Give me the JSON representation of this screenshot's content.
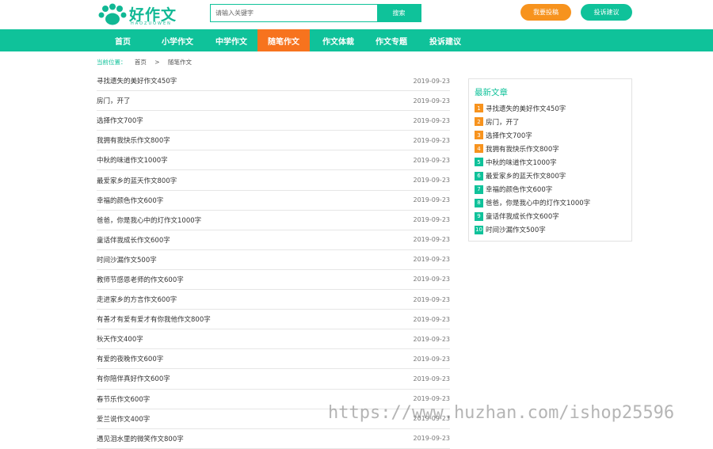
{
  "header": {
    "logo_text": "好作文",
    "logo_sub": "HAOZUOWEN",
    "search_placeholder": "请输入关键字",
    "search_button": "搜索",
    "submit_button": "我要投稿",
    "feedback_button": "投诉建议"
  },
  "nav": {
    "items": [
      {
        "label": "首页"
      },
      {
        "label": "小学作文"
      },
      {
        "label": "中学作文"
      },
      {
        "label": "随笔作文"
      },
      {
        "label": "作文体裁"
      },
      {
        "label": "作文专题"
      },
      {
        "label": "投诉建议"
      }
    ],
    "active_index": 3
  },
  "breadcrumb": {
    "label": "当前位置：",
    "home": "首页",
    "separator": ">",
    "current": "随笔作文"
  },
  "articles": [
    {
      "title": "寻找遗失的美好作文450字",
      "date": "2019-09-23"
    },
    {
      "title": "房门，开了",
      "date": "2019-09-23"
    },
    {
      "title": "选择作文700字",
      "date": "2019-09-23"
    },
    {
      "title": "我拥有我快乐作文800字",
      "date": "2019-09-23"
    },
    {
      "title": "中秋的味道作文1000字",
      "date": "2019-09-23"
    },
    {
      "title": "最爱家乡的蓝天作文800字",
      "date": "2019-09-23"
    },
    {
      "title": "幸福的颜色作文600字",
      "date": "2019-09-23"
    },
    {
      "title": "爸爸，你是我心中的灯作文1000字",
      "date": "2019-09-23"
    },
    {
      "title": "童话伴我成长作文600字",
      "date": "2019-09-23"
    },
    {
      "title": "时间沙漏作文500字",
      "date": "2019-09-23"
    },
    {
      "title": "教师节感恩老师的作文600字",
      "date": "2019-09-23"
    },
    {
      "title": "走进家乡的方言作文600字",
      "date": "2019-09-23"
    },
    {
      "title": "有善才有爱有爱才有你我他作文800字",
      "date": "2019-09-23"
    },
    {
      "title": "秋天作文400字",
      "date": "2019-09-23"
    },
    {
      "title": "有爱的夜晚作文600字",
      "date": "2019-09-23"
    },
    {
      "title": "有你陪伴真好作文600字",
      "date": "2019-09-23"
    },
    {
      "title": "春节乐作文600字",
      "date": "2019-09-23"
    },
    {
      "title": "爱兰说作文400字",
      "date": "2019-09-23"
    },
    {
      "title": "遇见泪水里的微笑作文800字",
      "date": "2019-09-23"
    }
  ],
  "sidebar": {
    "title": "最新文章",
    "items": [
      {
        "num": "1",
        "title": "寻找遗失的美好作文450字"
      },
      {
        "num": "2",
        "title": "房门，开了"
      },
      {
        "num": "3",
        "title": "选择作文700字"
      },
      {
        "num": "4",
        "title": "我拥有我快乐作文800字"
      },
      {
        "num": "5",
        "title": "中秋的味道作文1000字"
      },
      {
        "num": "6",
        "title": "最爱家乡的蓝天作文800字"
      },
      {
        "num": "7",
        "title": "幸福的颜色作文600字"
      },
      {
        "num": "8",
        "title": "爸爸，你是我心中的灯作文1000字"
      },
      {
        "num": "9",
        "title": "童话伴我成长作文600字"
      },
      {
        "num": "10",
        "title": "时间沙漏作文500字"
      }
    ]
  },
  "watermark": "https://www.huzhan.com/ishop25596",
  "colors": {
    "brand_green": "#0fc29a",
    "accent_orange": "#f7931e",
    "nav_active": "#f7731e"
  }
}
